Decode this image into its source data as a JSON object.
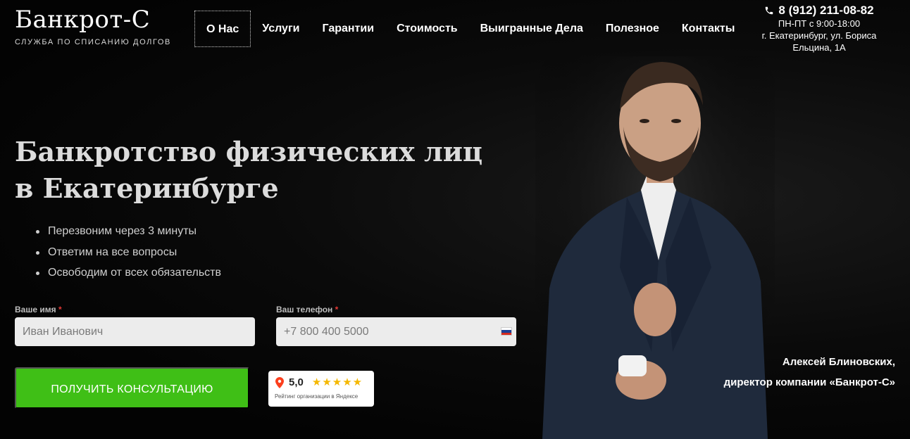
{
  "logo": {
    "title": "Банкрот-С",
    "subtitle": "служба по списанию долгов"
  },
  "nav": {
    "items": [
      {
        "label": "О Нас",
        "active": true
      },
      {
        "label": "Услуги"
      },
      {
        "label": "Гарантии"
      },
      {
        "label": "Стоимость"
      },
      {
        "label": "Выигранные Дела"
      },
      {
        "label": "Полезное"
      },
      {
        "label": "Контакты"
      }
    ]
  },
  "contact": {
    "phone": "8 (912) 211-08-82",
    "hours": "ПН-ПТ с 9:00-18:00",
    "address": "г. Екатеринбург, ул. Бориса Ельцина, 1А"
  },
  "hero": {
    "title": "Банкротство физических лиц в Екатеринбурге",
    "bullets": [
      "Перезвоним через 3 минуты",
      "Ответим на все вопросы",
      "Освободим от всех обязательств"
    ]
  },
  "form": {
    "name_label": "Ваше имя",
    "name_placeholder": "Иван Иванович",
    "phone_label": "Ваш телефон",
    "phone_placeholder": "+7 800 400 5000",
    "required_mark": "*",
    "submit_label": "Получить консультацию"
  },
  "rating": {
    "score": "5,0",
    "stars": 5,
    "caption": "Рейтинг организации в Яндексе"
  },
  "portrait_caption": {
    "name": "Алексей Блиновских,",
    "role": "директор компании «Банкрот-С»"
  },
  "colors": {
    "accent": "#3fbf16",
    "background": "#050505",
    "star": "#f5b800",
    "required": "#e53935"
  }
}
